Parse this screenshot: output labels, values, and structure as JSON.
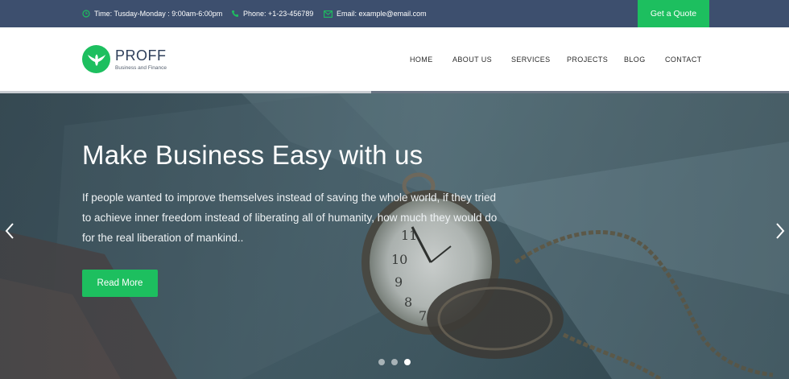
{
  "topbar": {
    "time": "Time: Tusday-Monday : 9:00am-6:00pm",
    "phone": "Phone: +1-23-456789",
    "email": "Email: example@email.com",
    "quote_label": "Get a Quote",
    "icons": [
      "clock-icon",
      "phone-icon",
      "envelope-icon"
    ]
  },
  "logo": {
    "name": "PROFF",
    "tagline": "Business and Finance",
    "icon": "eagle-icon"
  },
  "nav": {
    "items": [
      {
        "label": "HOME"
      },
      {
        "label": "ABOUT US"
      },
      {
        "label": "SERVICES"
      },
      {
        "label": "PROJECTS"
      },
      {
        "label": "BLOG"
      },
      {
        "label": "CONTACT"
      }
    ]
  },
  "slider": {
    "progress": 0.47
  },
  "hero": {
    "title": "Make Business Easy with us",
    "line1": "If people wanted to improve themselves instead of saving the whole world, if they tried",
    "line2": "to achieve inner freedom instead of liberating all of humanity, how much they would do",
    "line3": "for the real liberation of mankind..",
    "button_label": "Read More",
    "active_slide": 3,
    "slide_count": 3
  },
  "colors": {
    "topbar": "#3d4f6e",
    "accent": "#1dbf5f",
    "brand_text": "#2d3e5a"
  }
}
